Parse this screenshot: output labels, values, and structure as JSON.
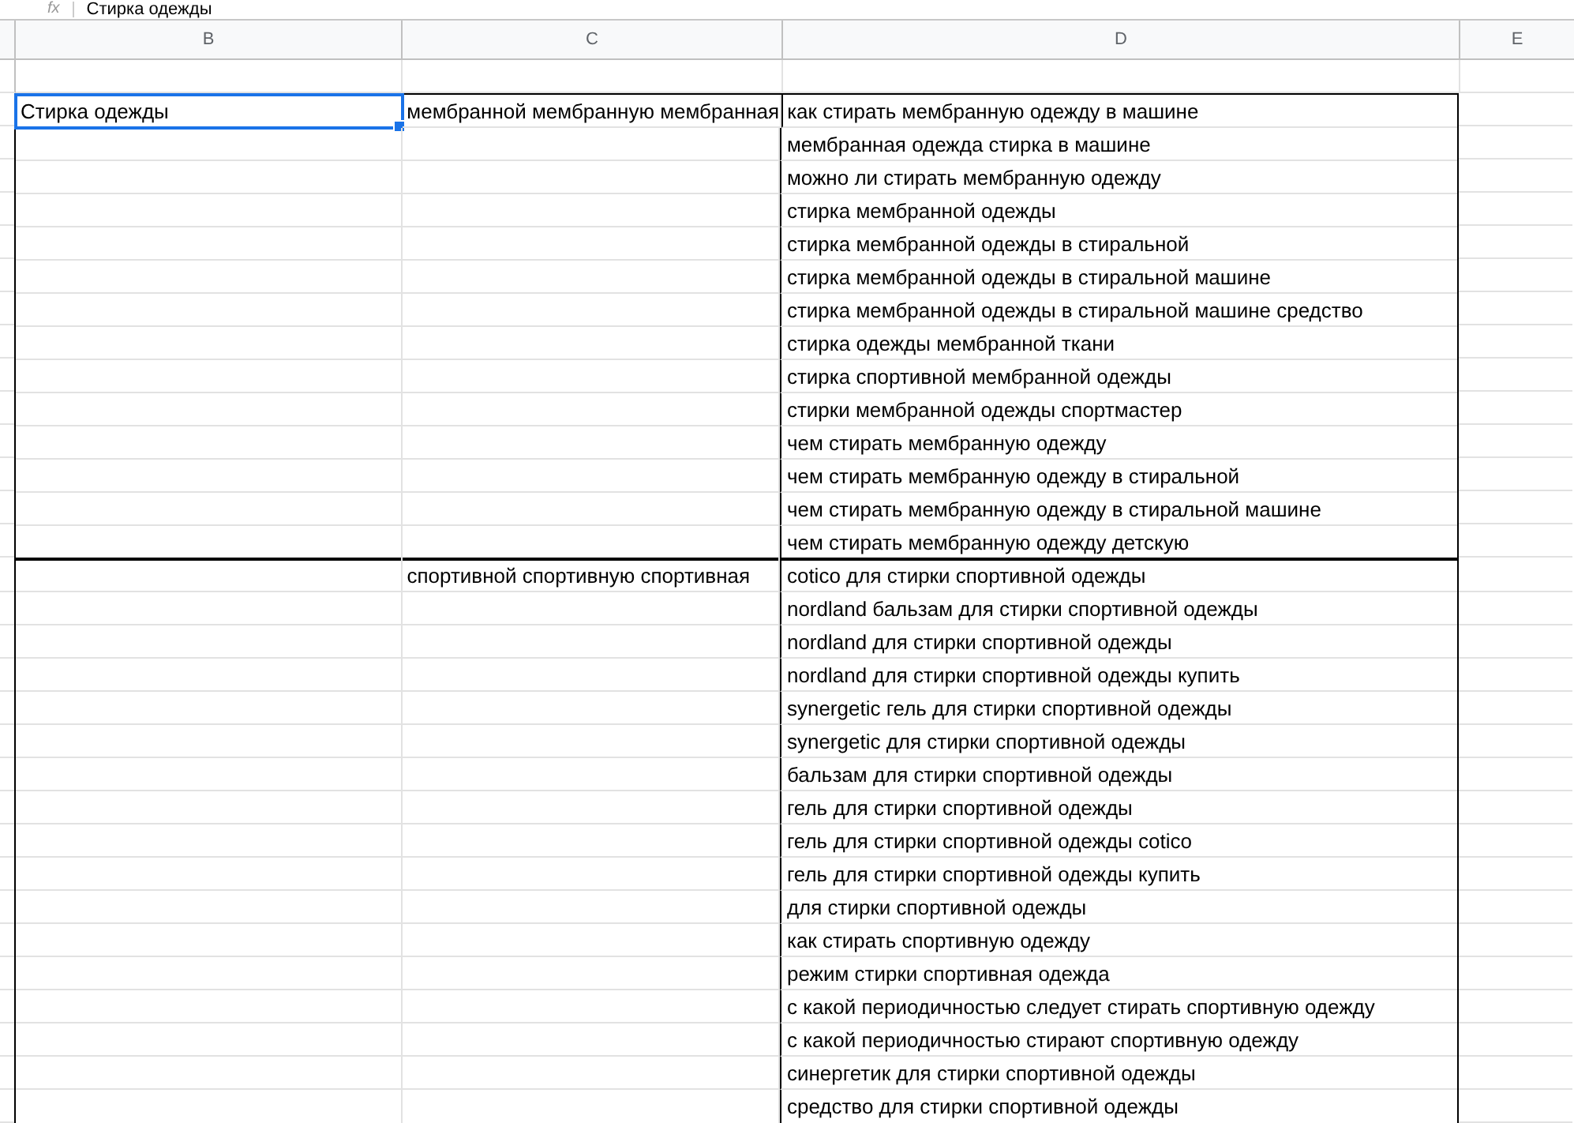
{
  "formula_bar": {
    "icon_text": "fx",
    "value": "Стирка одежды"
  },
  "columns": [
    "B",
    "C",
    "D",
    "E"
  ],
  "groups": [
    {
      "selected": true,
      "column_b": "Стирка одежды",
      "column_c": "мембранной мембранную мембранная",
      "column_d": [
        "как стирать мембранную одежду в машине",
        "мембранная одежда стирка в машине",
        "можно ли стирать мембранную одежду",
        "стирка мембранной одежды",
        "стирка мембранной одежды в стиральной",
        "стирка мембранной одежды в стиральной машине",
        "стирка мембранной одежды в стиральной машине средство",
        "стирка одежды мембранной ткани",
        "стирка спортивной мембранной одежды",
        "стирки мембранной одежды спортмастер",
        "чем стирать мембранную одежду",
        "чем стирать мембранную одежду в стиральной",
        "чем стирать мембранную одежду в стиральной машине",
        "чем стирать мембранную одежду детскую"
      ]
    },
    {
      "selected": false,
      "column_c": "спортивной спортивную спортивная",
      "column_d": [
        "cotico для стирки спортивной одежды",
        "nordland бальзам для стирки спортивной одежды",
        "nordland для стирки спортивной одежды",
        "nordland для стирки спортивной одежды купить",
        "synergetic гель для стирки спортивной одежды",
        "synergetic для стирки спортивной одежды",
        "бальзам для стирки спортивной одежды",
        "гель для стирки спортивной одежды",
        "гель для стирки спортивной одежды cotico",
        "гель для стирки спортивной одежды купить",
        "для стирки спортивной одежды",
        "как стирать спортивную одежду",
        "режим стирки спортивная одежда",
        "с какой периодичностью следует стирать спортивную одежду",
        "с какой периодичностью стирают спортивную одежду",
        "синергетик для стирки спортивной одежды",
        "средство для стирки спортивной одежды"
      ]
    }
  ]
}
